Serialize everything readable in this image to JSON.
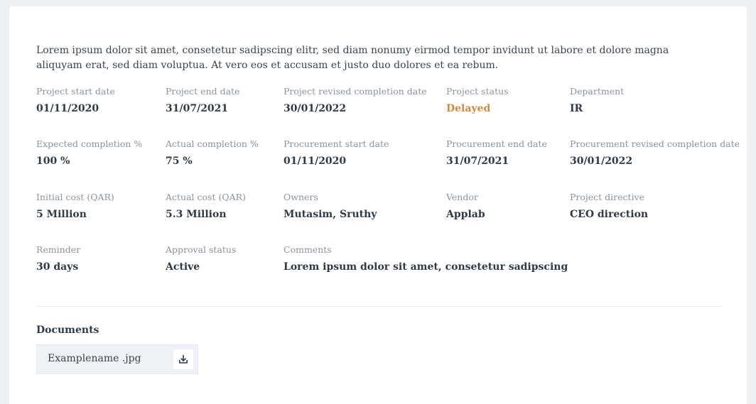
{
  "description": "Lorem ipsum dolor sit amet, consetetur sadipscing elitr, sed diam nonumy eirmod tempor invidunt ut labore et dolore magna aliquyam erat, sed diam voluptua. At vero eos et accusam et justo duo dolores et ea rebum.",
  "fields": {
    "project_start": {
      "label": "Project start date",
      "value": "01/11/2020"
    },
    "project_end": {
      "label": "Project end date",
      "value": "31/07/2021"
    },
    "project_revised": {
      "label": "Project revised completion date",
      "value": "30/01/2022"
    },
    "project_status": {
      "label": "Project status",
      "value": "Delayed"
    },
    "department": {
      "label": "Department",
      "value": "IR"
    },
    "expected_completion": {
      "label": "Expected completion %",
      "value": "100 %"
    },
    "actual_completion": {
      "label": "Actual completion %",
      "value": "75 %"
    },
    "procurement_start": {
      "label": "Procurement start date",
      "value": "01/11/2020"
    },
    "procurement_end": {
      "label": "Procurement end date",
      "value": "31/07/2021"
    },
    "procurement_revised": {
      "label": "Procurement revised completion date",
      "value": "30/01/2022"
    },
    "initial_cost": {
      "label": "Initial cost (QAR)",
      "value": "5 Million"
    },
    "actual_cost": {
      "label": "Actual cost (QAR)",
      "value": "5.3 Million"
    },
    "owners": {
      "label": "Owners",
      "value": "Mutasim, Sruthy"
    },
    "vendor": {
      "label": "Vendor",
      "value": "Applab"
    },
    "project_directive": {
      "label": "Project directive",
      "value": "CEO direction"
    },
    "reminder": {
      "label": "Reminder",
      "value": "30 days"
    },
    "approval_status": {
      "label": "Approval status",
      "value": "Active"
    },
    "comments": {
      "label": "Comments",
      "value": "Lorem ipsum dolor sit amet, consetetur sadipscing"
    }
  },
  "documents": {
    "title": "Documents",
    "file_name": "Examplename .jpg",
    "download_icon": "download-icon"
  },
  "colors": {
    "status_delayed": "#d0893e",
    "label": "#8a939c",
    "value": "#2f3a44"
  }
}
